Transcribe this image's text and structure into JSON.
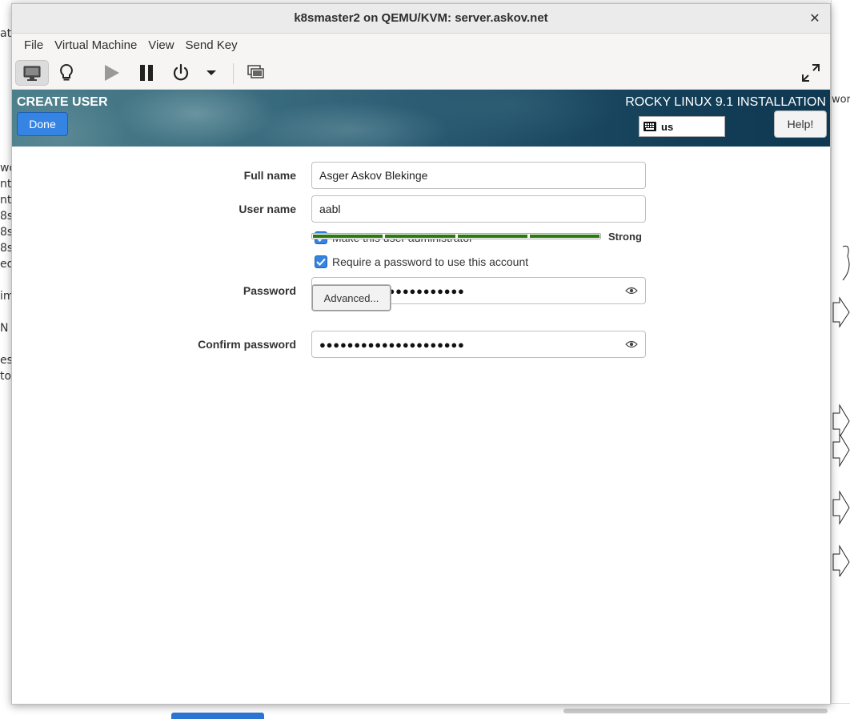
{
  "window": {
    "title": "k8smaster2 on QEMU/KVM: server.askov.net",
    "close_glyph": "✕"
  },
  "menubar": {
    "items": [
      "File",
      "Virtual Machine",
      "View",
      "Send Key"
    ]
  },
  "toolbar": {
    "icons": [
      "monitor-icon",
      "lightbulb-icon",
      "play-icon",
      "pause-icon",
      "power-icon",
      "dropdown-icon",
      "console-icon",
      "fullscreen-icon"
    ]
  },
  "installer": {
    "section_title": "CREATE USER",
    "done_label": "Done",
    "product_title": "ROCKY LINUX 9.1 INSTALLATION",
    "keyboard_layout": "us",
    "help_label": "Help!"
  },
  "form": {
    "full_name_label": "Full name",
    "full_name_value": "Asger Askov Blekinge",
    "user_name_label": "User name",
    "user_name_value": "aabl",
    "admin_checkbox_label": "Make this user administrator",
    "admin_checked": true,
    "require_password_label": "Require a password to use this account",
    "require_password_checked": true,
    "password_label": "Password",
    "password_mask": "●●●●●●●●●●●●●●●●●●●●●",
    "strength_label": "Strong",
    "strength_fraction": 1.0,
    "confirm_password_label": "Confirm password",
    "confirm_password_mask": "●●●●●●●●●●●●●●●●●●●●●",
    "advanced_label": "Advanced..."
  },
  "background": {
    "left_fragments": [
      "ate",
      "wo",
      "nte",
      "nte",
      "8s",
      "8s",
      "8s",
      "ed",
      "im",
      "N",
      "es",
      "tor"
    ],
    "right_fragment": "work"
  },
  "colors": {
    "accent": "#3584e4",
    "strength_bar": "#2a7a10",
    "banner_dark": "#0f3852"
  }
}
